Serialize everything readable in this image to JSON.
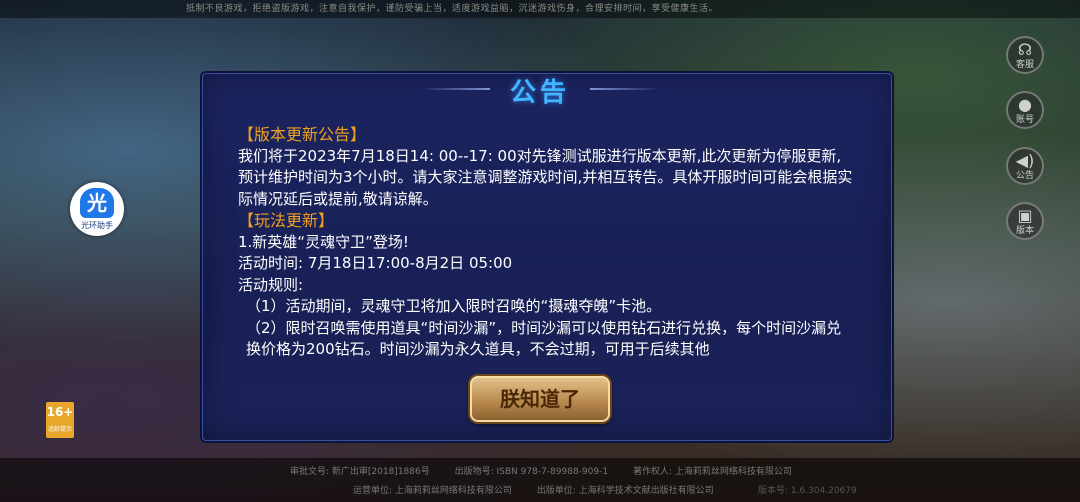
{
  "top_notice": "抵制不良游戏，拒绝盗版游戏，注意自我保护，谨防受骗上当，适度游戏益脑，沉迷游戏伤身，合理安排时间，享受健康生活。",
  "dialog": {
    "title": "公告",
    "lines": [
      {
        "text": "【版本更新公告】",
        "style": "hdr"
      },
      {
        "text": "我们将于2023年7月18日14: 00--17: 00对先锋测试服进行版本更新,此次更新为停服更新,预计维护时间为3个小时。请大家注意调整游戏时间,并相互转告。具体开服时间可能会根据实际情况延后或提前,敬请谅解。",
        "style": ""
      },
      {
        "text": "【玩法更新】",
        "style": "hdr"
      },
      {
        "text": "1.新英雄“灵魂守卫”登场!",
        "style": ""
      },
      {
        "text": "活动时间: 7月18日17:00-8月2日 05:00",
        "style": ""
      },
      {
        "text": "活动规则:",
        "style": ""
      },
      {
        "text": "（1）活动期间，灵魂守卫将加入限时召唤的“摄魂夺魄”卡池。",
        "style": "ind"
      },
      {
        "text": "（2）限时召唤需使用道具“时间沙漏”，时间沙漏可以使用钻石进行兑换，每个时间沙漏兑换价格为200钻石。时间沙漏为永久道具，不会过期，可用于后续其他",
        "style": "ind"
      }
    ],
    "ok_label": "朕知道了"
  },
  "assistant": {
    "icon_char": "光",
    "label": "光环助手"
  },
  "side_buttons": [
    {
      "icon": "customer-service-icon",
      "glyph": "☊",
      "label": "客服"
    },
    {
      "icon": "account-icon",
      "glyph": "●",
      "label": "账号"
    },
    {
      "icon": "announcement-icon",
      "glyph": "◀)",
      "label": "公告"
    },
    {
      "icon": "version-icon",
      "glyph": "▣",
      "label": "版本"
    }
  ],
  "age_rating": {
    "number": "16+",
    "label": "适龄提示"
  },
  "footer": {
    "row1": [
      "审批文号: 新广出审[2018]1886号",
      "出版物号: ISBN 978-7-89988-909-1",
      "著作权人: 上海莉莉丝网络科技有限公司"
    ],
    "row2": [
      "运营单位: 上海莉莉丝网络科技有限公司",
      "出版单位: 上海科学技术文献出版社有限公司"
    ],
    "row3": "版本号: 1.6.304.20679"
  }
}
